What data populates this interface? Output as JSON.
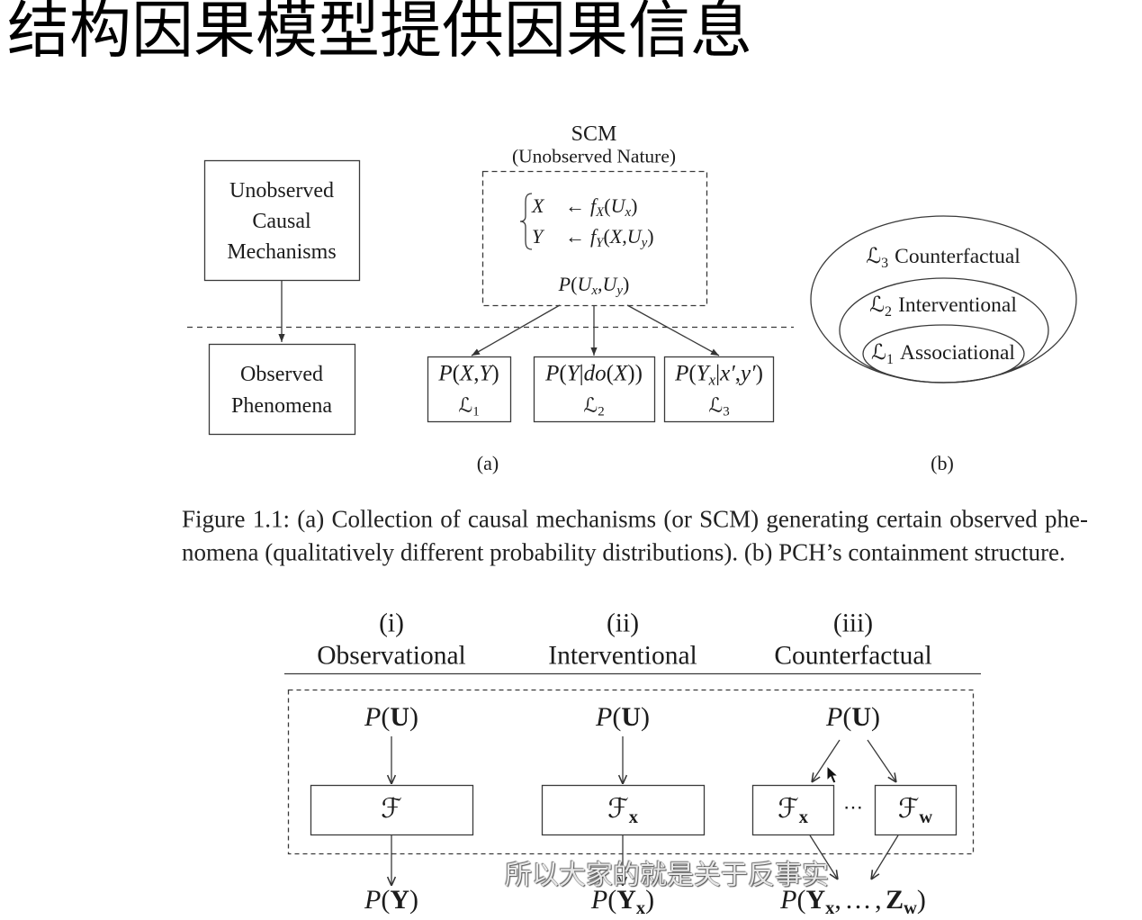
{
  "slide": {
    "title": "结构因果模型提供因果信息",
    "subtitle_caption": "所以大家的就是关于反事实"
  },
  "figure_a": {
    "scm_title": "SCM",
    "scm_subtitle": "(Unobserved Nature)",
    "mechanisms_lines": [
      "Unobserved",
      "Causal",
      "Mechanisms"
    ],
    "phenomena_lines": [
      "Observed",
      "Phenomena"
    ],
    "equation_x": [
      "X",
      "←",
      "f",
      "X",
      "(",
      "U",
      "x",
      ")"
    ],
    "equation_y": [
      "Y",
      "←",
      "f",
      "Y",
      "(",
      "X",
      ",",
      "U",
      "y",
      ")"
    ],
    "exogenous_distribution": [
      "P",
      "(",
      "U",
      "x",
      ",",
      "U",
      "y",
      ")"
    ],
    "distributions": [
      {
        "formula": [
          "P",
          "(",
          "X",
          ",",
          "Y",
          ")"
        ],
        "level": [
          "ℒ",
          "1"
        ]
      },
      {
        "formula": [
          "P",
          "(",
          "Y",
          "|",
          "do",
          "(",
          "X",
          "))"
        ],
        "level": [
          "ℒ",
          "2"
        ]
      },
      {
        "formula": [
          "P",
          "(",
          "Y",
          "x",
          "|",
          "x′",
          ",",
          "y′",
          ")"
        ],
        "level": [
          "ℒ",
          "3"
        ]
      }
    ],
    "panel_label": "(a)"
  },
  "figure_b": {
    "layers": [
      {
        "symbol": "ℒ",
        "index": "3",
        "name": "Counterfactual"
      },
      {
        "symbol": "ℒ",
        "index": "2",
        "name": "Interventional"
      },
      {
        "symbol": "ℒ",
        "index": "1",
        "name": "Associational"
      }
    ],
    "panel_label": "(b)"
  },
  "caption": {
    "line1": "Figure 1.1: (a) Collection of causal mechanisms (or SCM) generating certain observed phe-",
    "line2": "nomena (qualitatively different probability distributions). (b) PCH’s containment structure."
  },
  "pch_figure": {
    "columns": [
      {
        "numeral": "(i)",
        "name": "Observational",
        "input": [
          "P",
          "(",
          "U",
          ")"
        ],
        "model": [
          "ℱ"
        ],
        "output": [
          "P",
          "(",
          "Y",
          ")"
        ]
      },
      {
        "numeral": "(ii)",
        "name": "Interventional",
        "input": [
          "P",
          "(",
          "U",
          ")"
        ],
        "model": [
          "ℱ",
          "x"
        ],
        "output": [
          "P",
          "(",
          "Y",
          "x",
          ")"
        ]
      },
      {
        "numeral": "(iii)",
        "name": "Counterfactual",
        "input": [
          "P",
          "(",
          "U",
          ")"
        ],
        "models": [
          [
            "ℱ",
            "x"
          ],
          [
            "ℱ",
            "w"
          ]
        ],
        "ellipsis": "⋯",
        "output": [
          "P",
          "(",
          "Y",
          "x",
          ",",
          "…",
          ",",
          "Z",
          "w",
          ")"
        ]
      }
    ]
  }
}
